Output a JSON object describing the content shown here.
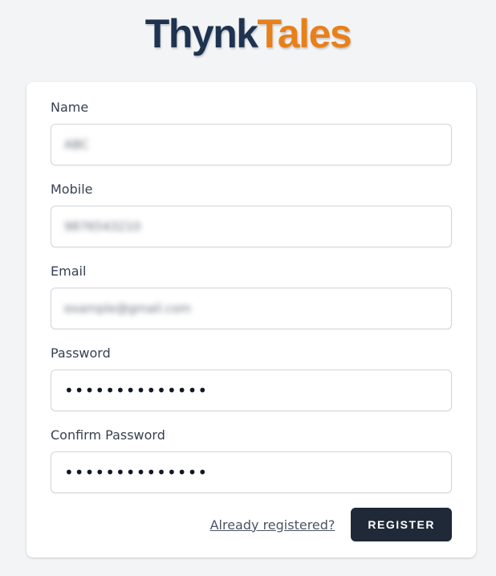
{
  "logo": {
    "part1": "Thynk",
    "part2": "Tales",
    "colors": {
      "part1": "#1e3350",
      "part2": "#e8801a"
    }
  },
  "form": {
    "fields": [
      {
        "label": "Name",
        "value": "ABC"
      },
      {
        "label": "Mobile",
        "value": "9876543210"
      },
      {
        "label": "Email",
        "value": "example@gmail.com"
      },
      {
        "label": "Password",
        "value": "••••••••••••••"
      },
      {
        "label": "Confirm Password",
        "value": "••••••••••••••"
      }
    ],
    "login_link": "Already registered?",
    "register_button": "REGISTER"
  },
  "colors": {
    "background": "#f3f4f6",
    "card": "#ffffff",
    "button": "#1f2937"
  }
}
